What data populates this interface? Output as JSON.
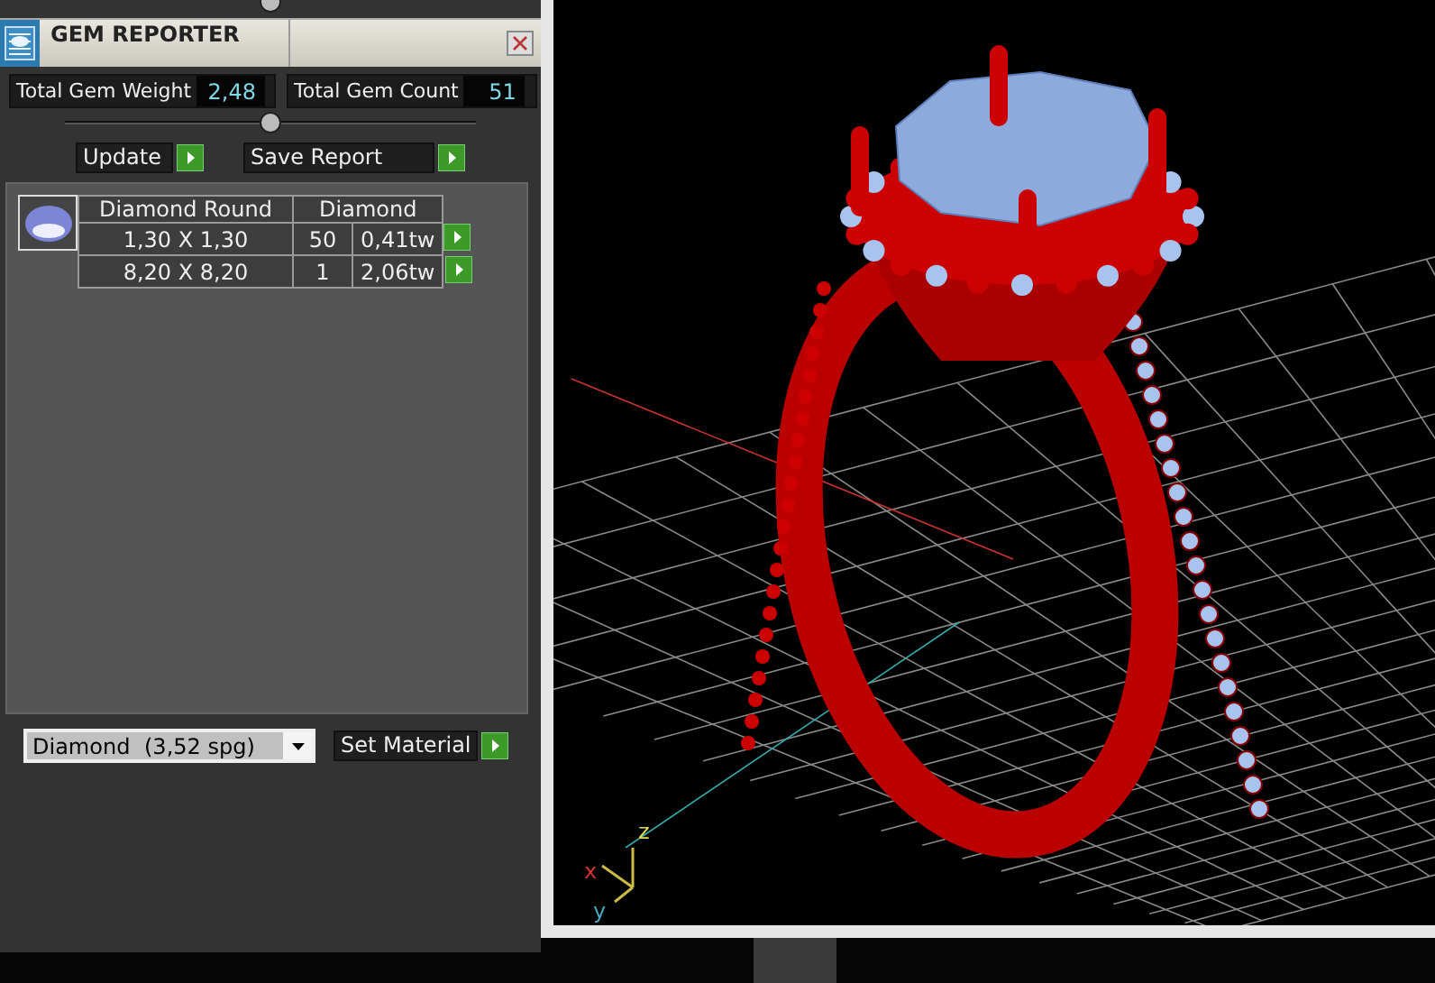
{
  "panel": {
    "title": "GEM REPORTER",
    "totals": [
      {
        "label": "Total Gem Weight",
        "value": "2,48"
      },
      {
        "label": "Total Gem Count",
        "value": "51"
      }
    ],
    "buttons": [
      "Update",
      "Save Report"
    ],
    "table": {
      "columns": [
        "Diamond Round",
        "Diamond"
      ],
      "rows": [
        {
          "size": "1,30 X 1,30",
          "count": "50",
          "weight": "0,41tw"
        },
        {
          "size": "8,20 X 8,20",
          "count": "1",
          "weight": "2,06tw"
        }
      ]
    },
    "material": {
      "name": "Diamond",
      "density": "(3,52 spg)"
    },
    "set_button": "Set Material"
  },
  "viewport": {
    "axes": [
      "z",
      "x",
      "y"
    ]
  }
}
